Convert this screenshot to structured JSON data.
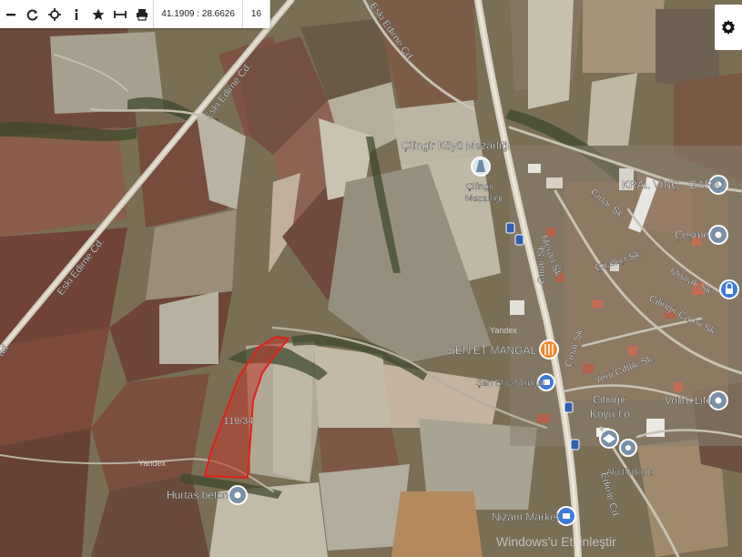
{
  "toolbar": {
    "coordinates": "41.1909 : 28.6626",
    "zoom": "16",
    "tools": [
      "minus-icon",
      "refresh-icon",
      "locate-icon",
      "info-icon",
      "star-icon",
      "measure-icon",
      "print-icon"
    ]
  },
  "settings_icon": "gear-icon",
  "parcel": {
    "label": "119/34",
    "fill": "#c0392b",
    "stroke": "#e0201c"
  },
  "roads": {
    "eski_edirne_1": "Eski Edirne Cd.",
    "eski_edirne_2": "Eski Edirne Cd.",
    "eski_edirne_3": "Eski Edirne Cd.",
    "eski_edirne_left": "ad",
    "cinar_1": "Çınar Sk.",
    "cinar_2": "Çınar Sk.",
    "cinar_3": "Çınar Sk.",
    "cicekci": "Çiçekçi Sk.",
    "misvak": "Misvak Sk.",
    "cilingir_camii": "Çilingir Camii Sk.",
    "yeni_ciftlik": "Yeni Çiftlik Sk.",
    "meran": "Meran Sk.",
    "edirne_cd": "Edirne Cd."
  },
  "pois": {
    "mezarligi_title": "Çilingir Köyü Mezarlığı",
    "mezarligi_sub1": "Çilingir",
    "mezarligi_sub2": "Mezarlığı",
    "kral_vinc": "KRAL VİNÇ - GARAJ",
    "cesme": "Çeşme",
    "sen_et_title": "ŞEN ET MANGAL",
    "sen_et_sub": "Şen Et & Mangal",
    "cilingir_1": "Çilingir",
    "cilingir_2": "Köyü İ.o",
    "volim": "Volim Life",
    "alp": "Alp İlkokulu",
    "hurtas": "Hurtas beton",
    "nizam": "Nizam Market",
    "yandex1": "Yandex",
    "yandex2": "Yandex"
  },
  "watermark": "Windows'u Etkinleştir"
}
